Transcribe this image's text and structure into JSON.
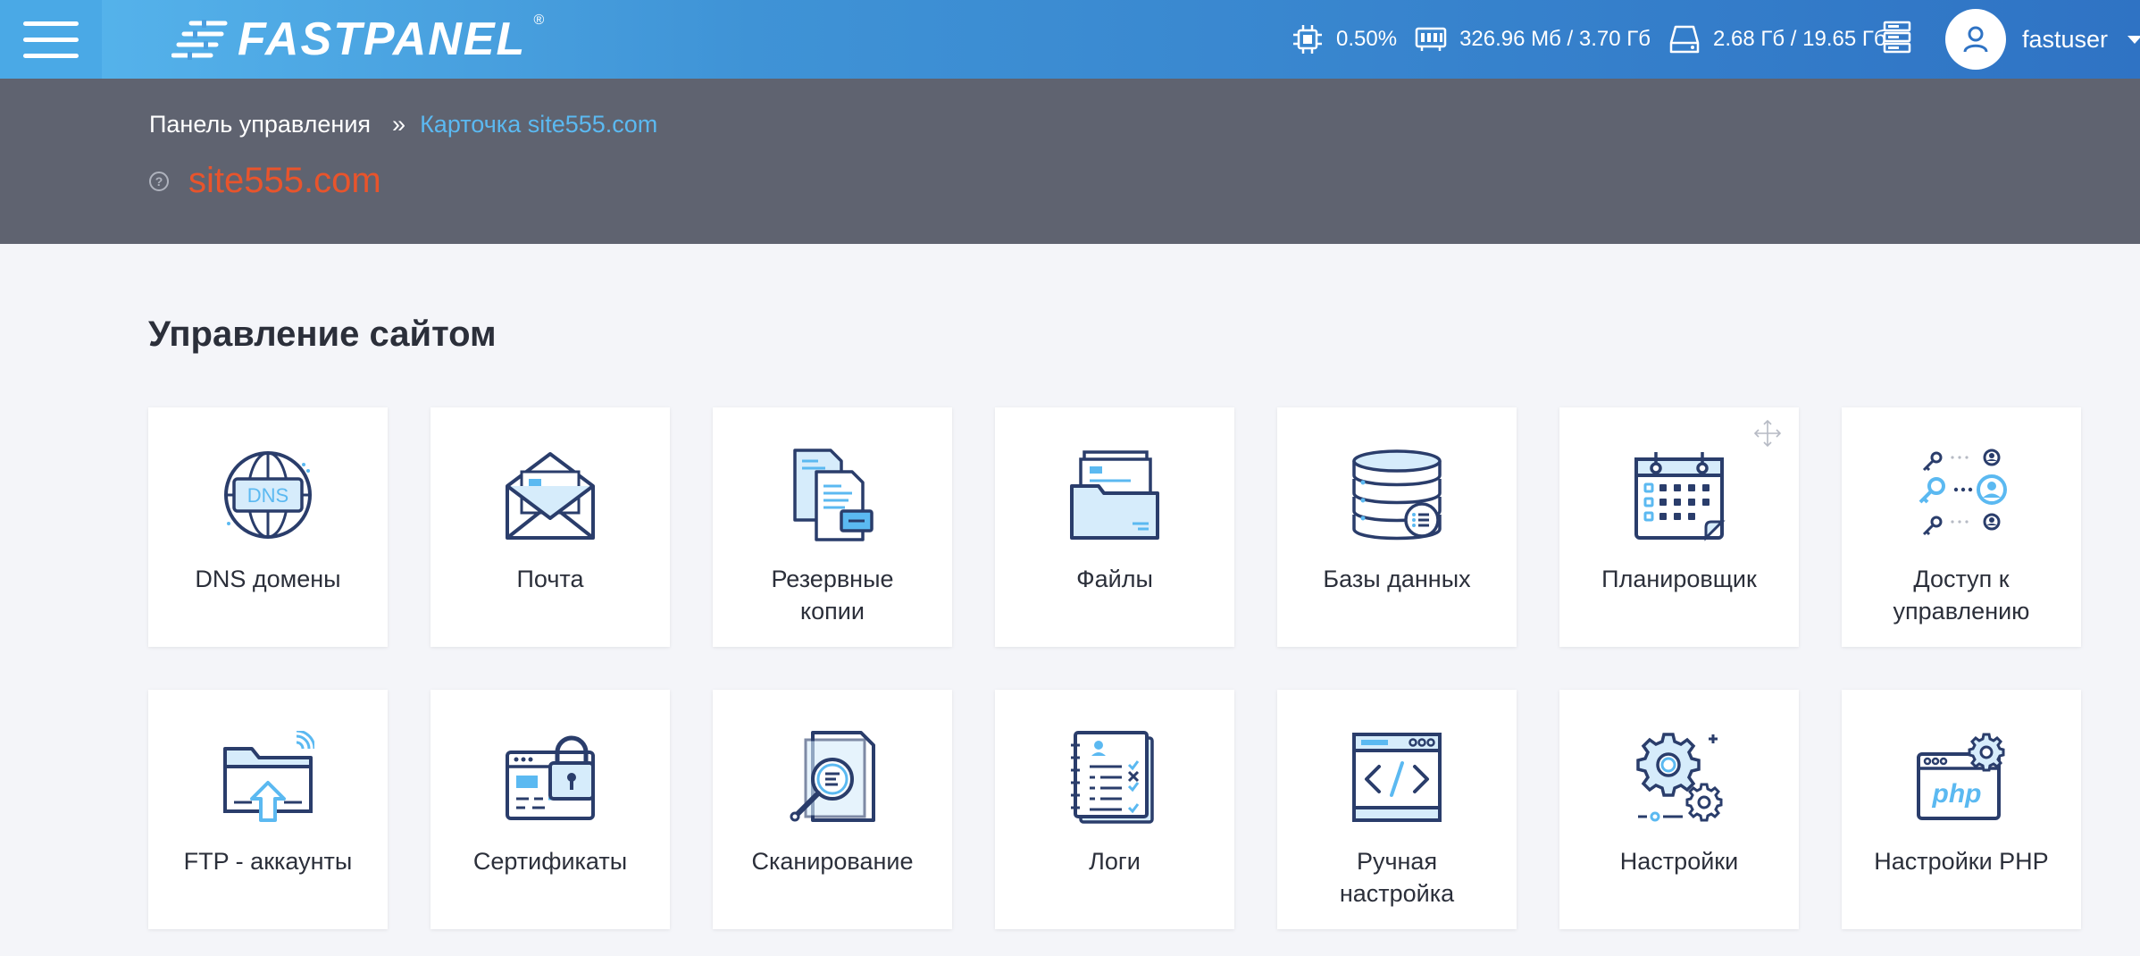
{
  "brand": {
    "name": "FASTPANEL",
    "registered_mark": "®"
  },
  "topbar": {
    "menu_icon": "hamburger-icon",
    "stats": [
      {
        "icon": "cpu-icon",
        "value": "0.50%"
      },
      {
        "icon": "memory-icon",
        "value": "326.96 Мб / 3.70 Гб"
      },
      {
        "icon": "disk-icon",
        "value": "2.68 Гб / 19.65 Гб"
      }
    ],
    "server_icon": "server-list-icon",
    "user": {
      "name": "fastuser",
      "icon": "user-icon"
    }
  },
  "breadcrumb": {
    "home": "Панель управления",
    "separator": "»",
    "current": "Карточка site555.com"
  },
  "site": {
    "name": "site555.com",
    "help": "?"
  },
  "section": {
    "title": "Управление сайтом"
  },
  "tiles": [
    {
      "id": "dns",
      "label": "DNS домены",
      "icon": "dns-globe-icon",
      "icon_text": "DNS"
    },
    {
      "id": "mail",
      "label": "Почта",
      "icon": "mail-envelope-icon"
    },
    {
      "id": "backup",
      "label": "Резервные копии",
      "icon": "backup-documents-icon"
    },
    {
      "id": "files",
      "label": "Файлы",
      "icon": "folder-files-icon"
    },
    {
      "id": "databases",
      "label": "Базы данных",
      "icon": "database-icon"
    },
    {
      "id": "scheduler",
      "label": "Планировщик",
      "icon": "calendar-icon"
    },
    {
      "id": "access",
      "label": "Доступ к управлению",
      "icon": "access-keys-icon"
    },
    {
      "id": "ftp",
      "label": "FTP - аккаунты",
      "icon": "ftp-folder-upload-icon"
    },
    {
      "id": "certs",
      "label": "Сертификаты",
      "icon": "certificate-lock-icon"
    },
    {
      "id": "scan",
      "label": "Сканирование",
      "icon": "scan-magnifier-icon"
    },
    {
      "id": "logs",
      "label": "Логи",
      "icon": "log-notebook-icon"
    },
    {
      "id": "manual",
      "label": "Ручная настройка",
      "icon": "code-window-icon"
    },
    {
      "id": "settings",
      "label": "Настройки",
      "icon": "gears-icon"
    },
    {
      "id": "php",
      "label": "Настройки PHP",
      "icon": "php-window-icon",
      "icon_text": "php"
    }
  ],
  "colors": {
    "accent": "#5bb9f1",
    "site_title": "#e8542c",
    "icon_dark": "#2a3d6b",
    "icon_light": "#5bb9f1",
    "band": "#5f6370"
  }
}
